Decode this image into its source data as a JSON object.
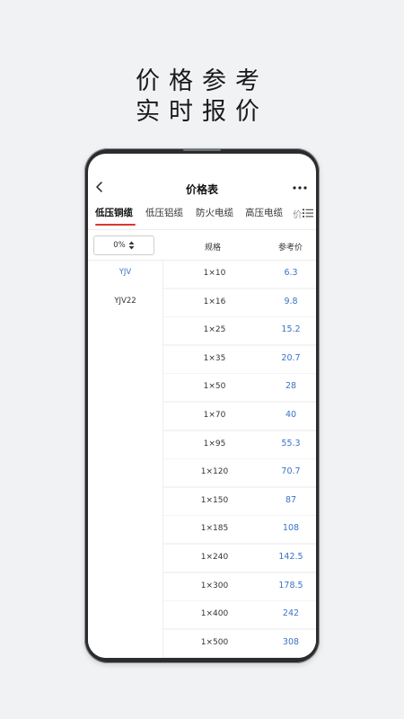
{
  "headline": {
    "line1": "价格参考",
    "line2": "实时报价"
  },
  "app": {
    "title": "价格表",
    "tabs": [
      "低压铜缆",
      "低压铝缆",
      "防火电缆",
      "高压电缆",
      "价"
    ],
    "active_tab": 0,
    "accent_color": "#d8382f",
    "price_color": "#3a73c8"
  },
  "sheet": {
    "percent_value": "0%",
    "col_spec": "规格",
    "col_price": "参考价",
    "models": [
      {
        "label": "YJV",
        "selected": true
      },
      {
        "label": "YJV22",
        "selected": false
      }
    ],
    "rows": [
      {
        "spec": "1×10",
        "price": "6.3"
      },
      {
        "spec": "1×16",
        "price": "9.8"
      },
      {
        "spec": "1×25",
        "price": "15.2"
      },
      {
        "spec": "1×35",
        "price": "20.7"
      },
      {
        "spec": "1×50",
        "price": "28"
      },
      {
        "spec": "1×70",
        "price": "40"
      },
      {
        "spec": "1×95",
        "price": "55.3"
      },
      {
        "spec": "1×120",
        "price": "70.7"
      },
      {
        "spec": "1×150",
        "price": "87"
      },
      {
        "spec": "1×185",
        "price": "108"
      },
      {
        "spec": "1×240",
        "price": "142.5"
      },
      {
        "spec": "1×300",
        "price": "178.5"
      },
      {
        "spec": "1×400",
        "price": "242"
      },
      {
        "spec": "1×500",
        "price": "308"
      }
    ]
  }
}
